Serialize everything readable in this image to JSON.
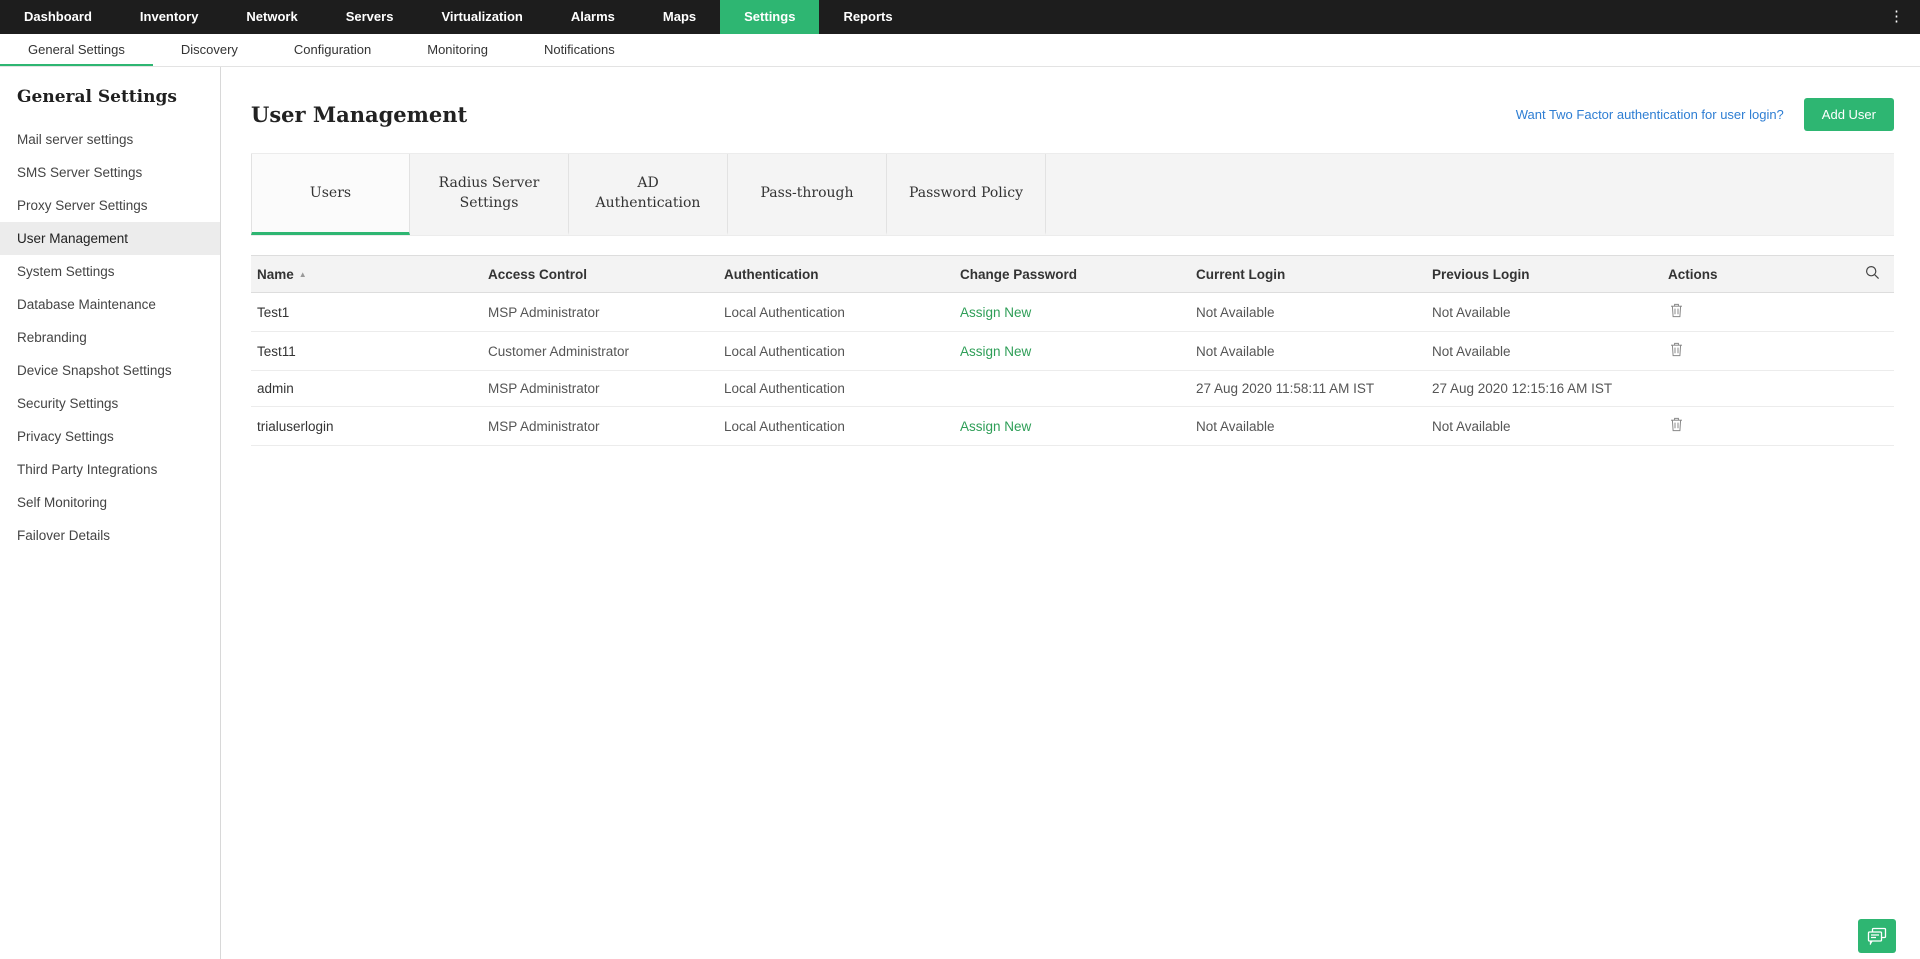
{
  "top_nav": {
    "items": [
      {
        "label": "Dashboard",
        "active": false
      },
      {
        "label": "Inventory",
        "active": false
      },
      {
        "label": "Network",
        "active": false
      },
      {
        "label": "Servers",
        "active": false
      },
      {
        "label": "Virtualization",
        "active": false
      },
      {
        "label": "Alarms",
        "active": false
      },
      {
        "label": "Maps",
        "active": false
      },
      {
        "label": "Settings",
        "active": true
      },
      {
        "label": "Reports",
        "active": false
      }
    ],
    "overflow_menu_icon": "kebab-menu"
  },
  "sub_nav": {
    "items": [
      {
        "label": "General Settings",
        "active": true
      },
      {
        "label": "Discovery",
        "active": false
      },
      {
        "label": "Configuration",
        "active": false
      },
      {
        "label": "Monitoring",
        "active": false
      },
      {
        "label": "Notifications",
        "active": false
      }
    ]
  },
  "sidebar": {
    "title": "General Settings",
    "items": [
      {
        "label": "Mail server settings",
        "active": false
      },
      {
        "label": "SMS Server Settings",
        "active": false
      },
      {
        "label": "Proxy Server Settings",
        "active": false
      },
      {
        "label": "User Management",
        "active": true
      },
      {
        "label": "System Settings",
        "active": false
      },
      {
        "label": "Database Maintenance",
        "active": false
      },
      {
        "label": "Rebranding",
        "active": false
      },
      {
        "label": "Device Snapshot Settings",
        "active": false
      },
      {
        "label": "Security Settings",
        "active": false
      },
      {
        "label": "Privacy Settings",
        "active": false
      },
      {
        "label": "Third Party Integrations",
        "active": false
      },
      {
        "label": "Self Monitoring",
        "active": false
      },
      {
        "label": "Failover Details",
        "active": false
      }
    ]
  },
  "main": {
    "title": "User Management",
    "two_factor_link": "Want Two Factor authentication for user login?",
    "add_user_button": "Add User",
    "tabs": [
      {
        "label": "Users",
        "active": true
      },
      {
        "label": "Radius Server Settings",
        "active": false
      },
      {
        "label": "AD Authentication",
        "active": false
      },
      {
        "label": "Pass-through",
        "active": false
      },
      {
        "label": "Password Policy",
        "active": false
      }
    ],
    "table": {
      "columns": [
        "Name",
        "Access Control",
        "Authentication",
        "Change Password",
        "Current Login",
        "Previous Login",
        "Actions"
      ],
      "sort_icon": "sort-ascending-caret",
      "search_icon": "search-icon",
      "rows": [
        {
          "name": "Test1",
          "access_control": "MSP Administrator",
          "authentication": "Local Authentication",
          "change_password": "Assign New",
          "current_login": "Not Available",
          "previous_login": "Not Available",
          "delete_icon": "trash-icon"
        },
        {
          "name": "Test11",
          "access_control": "Customer Administrator",
          "authentication": "Local Authentication",
          "change_password": "Assign New",
          "current_login": "Not Available",
          "previous_login": "Not Available",
          "delete_icon": "trash-icon"
        },
        {
          "name": "admin",
          "access_control": "MSP Administrator",
          "authentication": "Local Authentication",
          "change_password": "",
          "current_login": "27 Aug 2020 11:58:11 AM IST",
          "previous_login": "27 Aug 2020 12:15:16 AM IST",
          "delete_icon": ""
        },
        {
          "name": "trialuserlogin",
          "access_control": "MSP Administrator",
          "authentication": "Local Authentication",
          "change_password": "Assign New",
          "current_login": "Not Available",
          "previous_login": "Not Available",
          "delete_icon": "trash-icon"
        }
      ]
    },
    "chat_fab_icon": "chat-feedback-icon"
  },
  "colors": {
    "accent_green": "#2eb672",
    "link_blue": "#2e7ed3",
    "assign_link_green": "#2e9e57",
    "top_nav_bg": "#1d1d1d"
  }
}
